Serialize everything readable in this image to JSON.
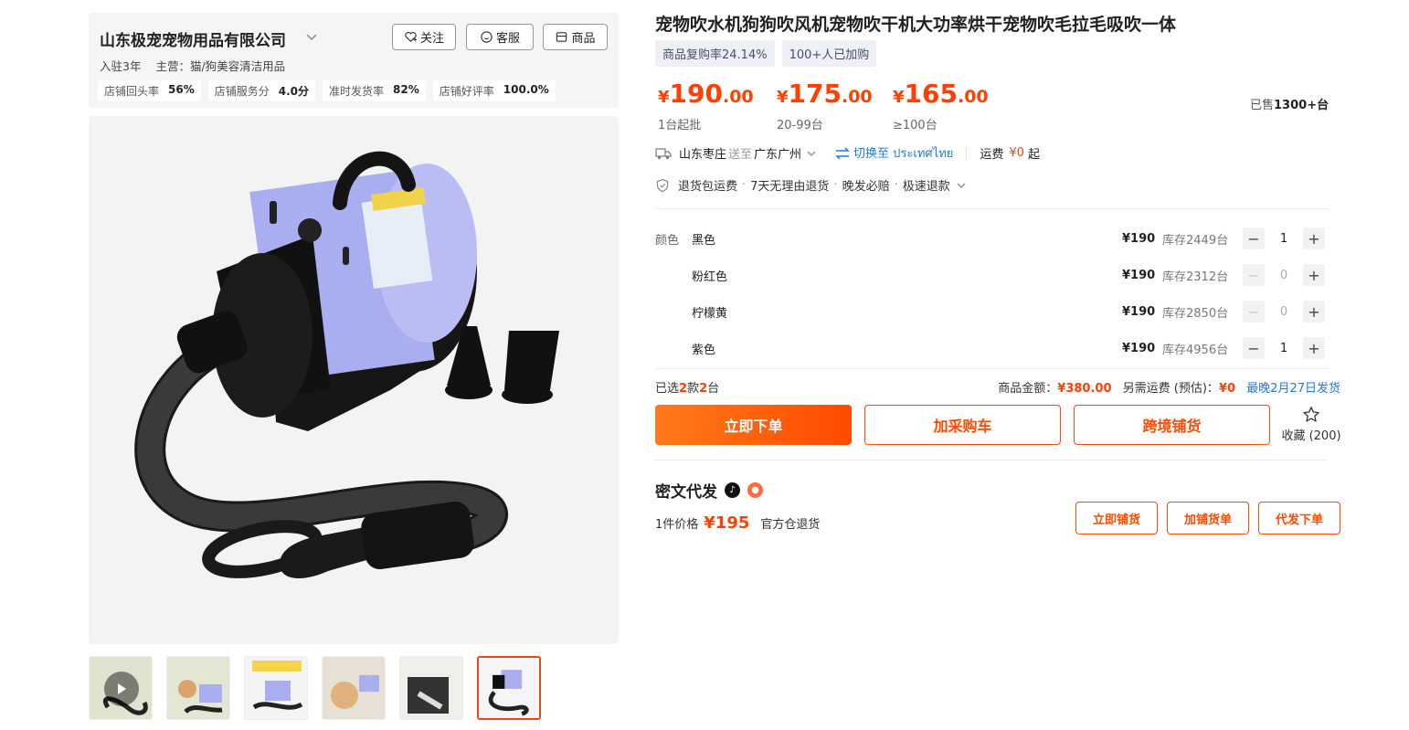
{
  "shop": {
    "name": "山东极宠宠物用品有限公司",
    "follow_label": "关注",
    "service_label": "客服",
    "products_label": "商品",
    "years": "入驻3年",
    "main_business": "主营：猫/狗美容清洁用品",
    "stats": [
      {
        "label": "店铺回头率",
        "value": "56%"
      },
      {
        "label": "店铺服务分",
        "value": "4.0分"
      },
      {
        "label": "准时发货率",
        "value": "82%"
      },
      {
        "label": "店铺好评率",
        "value": "100.0%"
      }
    ]
  },
  "product": {
    "title": "宠物吹水机狗狗吹风机宠物吹干机大功率烘干宠物吹毛拉毛吸吹一体",
    "tags": [
      "商品复购率24.14%",
      "100+人已加购"
    ],
    "prices": [
      {
        "yen": "¥",
        "int": "190",
        "dec": ".00",
        "cond": "1台起批"
      },
      {
        "yen": "¥",
        "int": "175",
        "dec": ".00",
        "cond": "20-99台"
      },
      {
        "yen": "¥",
        "int": "165",
        "dec": ".00",
        "cond": "≥100台"
      }
    ],
    "sold_prefix": "已售",
    "sold_value": "1300+台"
  },
  "shipping": {
    "from": "山东枣庄",
    "send_to": "送至",
    "to": "广东广州",
    "switch_label": "切换至 ประเทศไทย",
    "fee_label": "运费",
    "fee_value": "¥0",
    "fee_suffix": "起"
  },
  "guarantees": [
    "退货包运费",
    "7天无理由退货",
    "晚发必赔",
    "极速退款"
  ],
  "sku": {
    "label": "颜色",
    "items": [
      {
        "name": "黑色",
        "price": "¥190",
        "stock": "库存2449台",
        "qty": "1"
      },
      {
        "name": "粉红色",
        "price": "¥190",
        "stock": "库存2312台",
        "qty": "0"
      },
      {
        "name": "柠檬黄",
        "price": "¥190",
        "stock": "库存2850台",
        "qty": "0"
      },
      {
        "name": "紫色",
        "price": "¥190",
        "stock": "库存4956台",
        "qty": "1"
      }
    ]
  },
  "summary": {
    "sel_prefix": "已选",
    "sel_kinds": "2",
    "sel_mid": "款",
    "sel_units": "2",
    "sel_suffix": "台",
    "amount_label": "商品金额：",
    "amount_value": "¥380.00",
    "freight_label": "另需运费 (预估)：",
    "freight_value": "¥0",
    "delivery": "最晚2月27日发货"
  },
  "actions": {
    "order_now": "立即下单",
    "add_cart": "加采购车",
    "cross_border": "跨境铺货",
    "favorite": "收藏 (200)"
  },
  "dropship": {
    "title": "密文代发",
    "price_label": "1件价格",
    "price_value": "¥195",
    "return_note": "官方仓退货",
    "btn_list": "立即铺货",
    "btn_add": "加铺货单",
    "btn_order": "代发下单"
  },
  "colors": {
    "accent": "#ff4000",
    "link": "#1f7bd9",
    "product_body": "#a9aef0"
  }
}
